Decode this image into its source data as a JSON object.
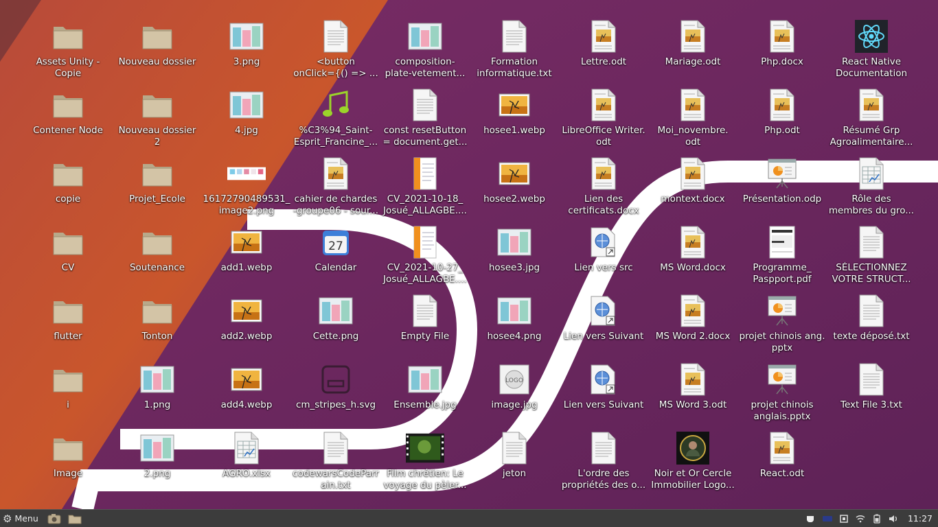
{
  "desktop": {
    "icons": [
      {
        "label": "Assets Unity -\nCopie",
        "type": "folder"
      },
      {
        "label": "Contener Node",
        "type": "folder"
      },
      {
        "label": "copie",
        "type": "folder"
      },
      {
        "label": "CV",
        "type": "folder"
      },
      {
        "label": "flutter",
        "type": "folder"
      },
      {
        "label": "i",
        "type": "folder"
      },
      {
        "label": "Image",
        "type": "folder"
      },
      {
        "label": "Nouveau dossier",
        "type": "folder"
      },
      {
        "label": "Nouveau dossier\n2",
        "type": "folder"
      },
      {
        "label": "Projet_Ecole",
        "type": "folder"
      },
      {
        "label": "Soutenance",
        "type": "folder"
      },
      {
        "label": "Tonton",
        "type": "folder"
      },
      {
        "label": "1.png",
        "type": "photo"
      },
      {
        "label": "2.png",
        "type": "photo"
      },
      {
        "label": "3.png",
        "type": "photo"
      },
      {
        "label": "4.jpg",
        "type": "photo"
      },
      {
        "label": "16172790489531_\nimage2.png",
        "type": "swatch"
      },
      {
        "label": "add1.webp",
        "type": "image"
      },
      {
        "label": "add2.webp",
        "type": "image"
      },
      {
        "label": "add4.webp",
        "type": "image"
      },
      {
        "label": "AGRO.xlsx",
        "type": "sheet"
      },
      {
        "label": "<button\nonClick={() => ...",
        "type": "text"
      },
      {
        "label": "%C3%94_Saint-\nEsprit_Francine_...",
        "type": "music"
      },
      {
        "label": "cahier de chardes\n-groupe06 - sour...",
        "type": "doc"
      },
      {
        "label": "Calendar",
        "type": "calendar"
      },
      {
        "label": "Cette.png",
        "type": "photo"
      },
      {
        "label": "cm_stripes_h.svg",
        "type": "svg"
      },
      {
        "label": "codewarsCodeParr\nain.txt",
        "type": "text"
      },
      {
        "label": "composition-\nplate-vetement...",
        "type": "photo"
      },
      {
        "label": "const resetButton\n= document.get...",
        "type": "text"
      },
      {
        "label": "CV_2021-10-18_\nJosué_ALLAGBE....",
        "type": "pdfcv"
      },
      {
        "label": "CV_2021-10-27_\nJosué_ALLAGBE....",
        "type": "pdfcv"
      },
      {
        "label": "Empty File",
        "type": "text"
      },
      {
        "label": "Ensemble.jpg",
        "type": "photo"
      },
      {
        "label": "Film chrétien: Le\nvoyage du pèler...",
        "type": "video"
      },
      {
        "label": "Formation\ninformatique.txt",
        "type": "text"
      },
      {
        "label": "hosee1.webp",
        "type": "image"
      },
      {
        "label": "hosee2.webp",
        "type": "image"
      },
      {
        "label": "hosee3.jpg",
        "type": "photo"
      },
      {
        "label": "hosee4.png",
        "type": "photo"
      },
      {
        "label": "image.jpg",
        "type": "logo"
      },
      {
        "label": "jeton",
        "type": "text"
      },
      {
        "label": "Lettre.odt",
        "type": "doc"
      },
      {
        "label": "LibreOffice Writer.\nodt",
        "type": "doc"
      },
      {
        "label": "Lien des\ncertificats.docx",
        "type": "doc"
      },
      {
        "label": "Lien vers src",
        "type": "link"
      },
      {
        "label": "Lien vers Suivant",
        "type": "link"
      },
      {
        "label": "Lien vers Suivant",
        "type": "link"
      },
      {
        "label": "L'ordre des\npropriétés des o...",
        "type": "text"
      },
      {
        "label": "Mariage.odt",
        "type": "doc"
      },
      {
        "label": "Moi_novembre.\nodt",
        "type": "doc"
      },
      {
        "label": "montext.docx",
        "type": "doc"
      },
      {
        "label": "MS Word.docx",
        "type": "doc"
      },
      {
        "label": "MS Word 2.docx",
        "type": "doc"
      },
      {
        "label": "MS Word 3.odt",
        "type": "doc"
      },
      {
        "label": "Noir et Or Cercle\nImmobilier Logo...",
        "type": "avatar"
      },
      {
        "label": "Php.docx",
        "type": "doc"
      },
      {
        "label": "Php.odt",
        "type": "doc"
      },
      {
        "label": "Présentation.odp",
        "type": "presentation"
      },
      {
        "label": "Programme_\nPaspport.pdf",
        "type": "pdf"
      },
      {
        "label": "projet chinois ang.\npptx",
        "type": "presentation"
      },
      {
        "label": "projet chinois\nanglais.pptx",
        "type": "presentation"
      },
      {
        "label": "React.odt",
        "type": "doc"
      },
      {
        "label": "React Native\nDocumentation",
        "type": "react"
      },
      {
        "label": "Résumé Grp\nAgroalimentaire...",
        "type": "doc"
      },
      {
        "label": "Rôle des\nmembres du gro...",
        "type": "sheet"
      },
      {
        "label": "SÉLECTIONNEZ\nVOTRE STRUCT...",
        "type": "text"
      },
      {
        "label": "texte déposé.txt",
        "type": "text"
      },
      {
        "label": "Text File 3.txt",
        "type": "text"
      }
    ]
  },
  "taskbar": {
    "menu_label": "Menu",
    "menu_icon": "gear-icon",
    "launchers": [
      "screenshot-icon",
      "files-icon"
    ],
    "tray": [
      "coffee-icon",
      "keyboard-icon",
      "display-icon",
      "wifi-icon",
      "battery-icon",
      "speaker-icon"
    ],
    "clock": "11:27"
  },
  "colors": {
    "wallpaper_orange": "#c5552c",
    "wallpaper_purple": "#6e2a62",
    "taskbar": "#3c3c3c",
    "folder": "#c9b99a"
  }
}
